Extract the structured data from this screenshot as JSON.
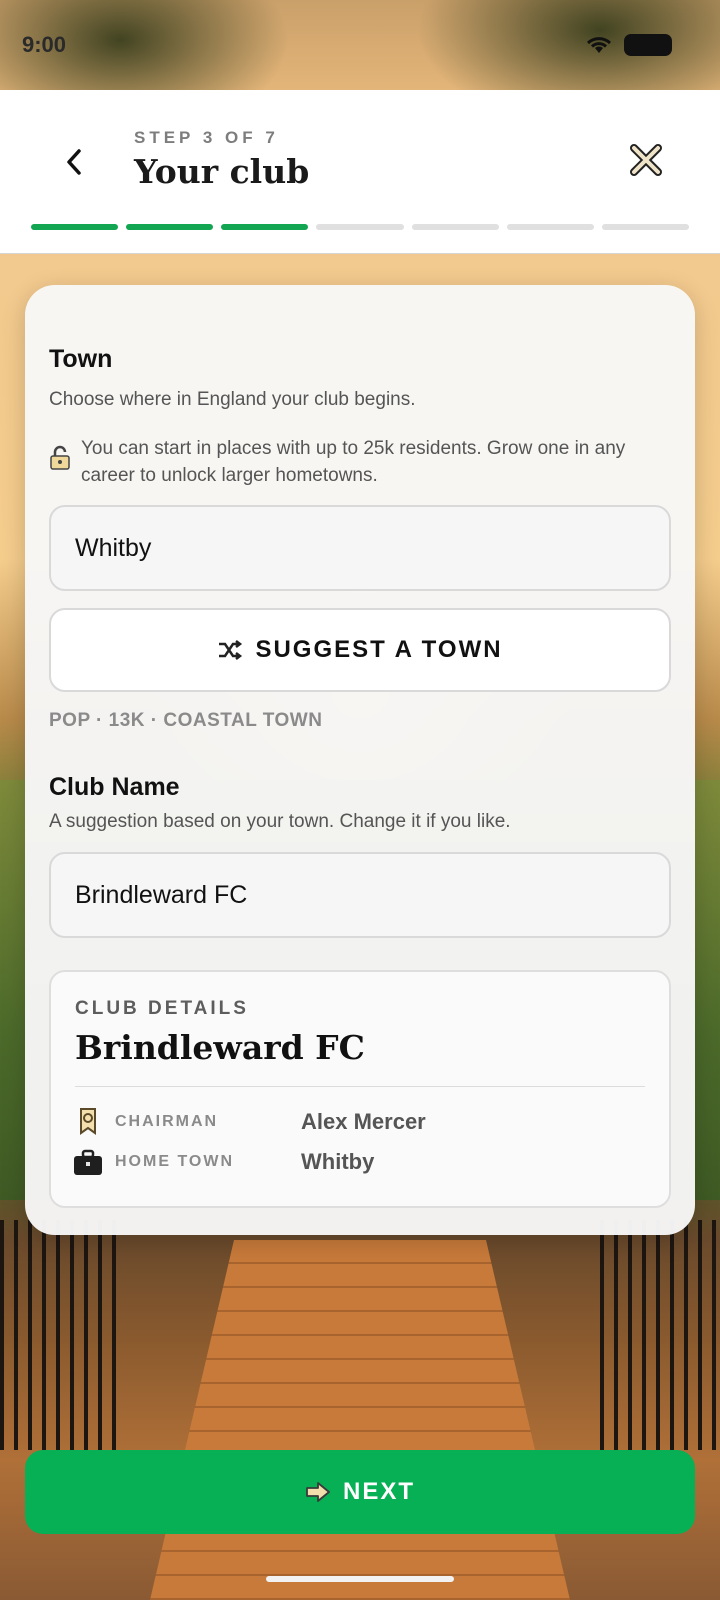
{
  "status_bar": {
    "time": "9:00"
  },
  "header": {
    "step_label": "STEP 3 OF 7",
    "title": "Your club",
    "progress": {
      "current_step": 3,
      "total_steps": 7
    }
  },
  "town_section": {
    "title": "Town",
    "subtitle": "Choose where in England your club begins.",
    "lock_note": "You can start in places with up to 25k residents. Grow one in any career to unlock larger hometowns.",
    "input_value": "Whitby",
    "suggest_label": "SUGGEST A TOWN",
    "town_meta": "POP · 13K · COASTAL TOWN"
  },
  "club_name_section": {
    "title": "Club Name",
    "subtitle": "A suggestion based on your town. Change it if you like.",
    "input_value": "Brindleward FC"
  },
  "club_details": {
    "label": "CLUB DETAILS",
    "name": "Brindleward FC",
    "rows": [
      {
        "key": "CHAIRMAN",
        "value": "Alex Mercer",
        "icon": "rosette-icon"
      },
      {
        "key": "HOME TOWN",
        "value": "Whitby",
        "icon": "briefcase-icon"
      }
    ]
  },
  "footer": {
    "next_label": "NEXT"
  },
  "colors": {
    "accent_green": "#07b055",
    "progress_done": "#12a552",
    "progress_pending": "#e0e0e0"
  }
}
